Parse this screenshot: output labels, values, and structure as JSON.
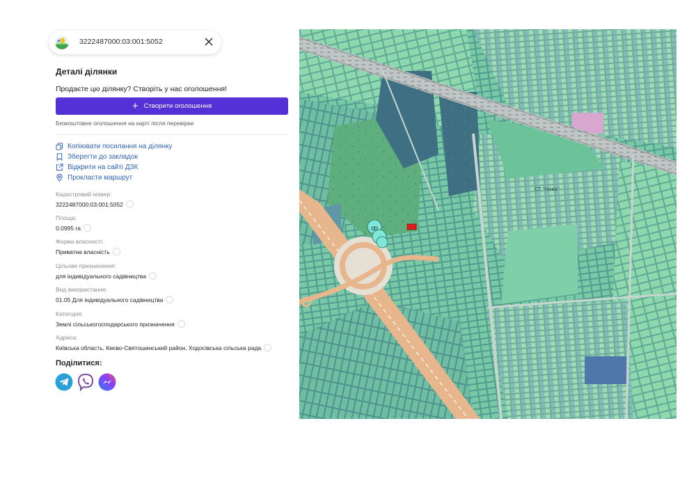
{
  "search": {
    "cadastral_number": "3222487000:03:001:5052"
  },
  "panel": {
    "title": "Деталі ділянки",
    "sell_prompt": "Продаєте цю ділянку? Створіть у нас оголошення!",
    "create_button_label": "Створити оголошення",
    "free_note": "Безкоштовне оголошення на карті після перевірки"
  },
  "actions": [
    {
      "label": "Копіювати посилання на ділянку",
      "icon": "copy-icon"
    },
    {
      "label": "Зберегти до закладок",
      "icon": "bookmark-icon"
    },
    {
      "label": "Відкрити на сайті ДЗК",
      "icon": "external-link-icon"
    },
    {
      "label": "Прокласти маршрут",
      "icon": "location-pin-icon"
    }
  ],
  "fields": [
    {
      "label": "Кадастровий номер:",
      "value": "3222487000:03:001:5052"
    },
    {
      "label": "Площа:",
      "value": "0.0995 га"
    },
    {
      "label": "Форма власності:",
      "value": "Приватна власність"
    },
    {
      "label": "Цільове призначення:",
      "value": "для індивідуального садівництва"
    },
    {
      "label": "Вид використання:",
      "value": "01.05 Для індивідуального садівництва"
    },
    {
      "label": "Категорія:",
      "value": "Землі сільськогосподарського призначення"
    },
    {
      "label": "Адреса:",
      "value": "Київська область, Києво-Святошинський район, Ходосівська сільська рада"
    }
  ],
  "share": {
    "title": "Поділитися:",
    "icons": [
      "telegram-icon",
      "viber-icon",
      "messenger-icon"
    ]
  },
  "map": {
    "labels": [
      "СТ \"Нива\""
    ]
  },
  "colors": {
    "accent": "#5331d6",
    "link": "#2e62b8",
    "selected_parcel": "#e21d1d",
    "parcel_green": "#7fd3a6",
    "parcel_blue": "#5f8fb2"
  }
}
